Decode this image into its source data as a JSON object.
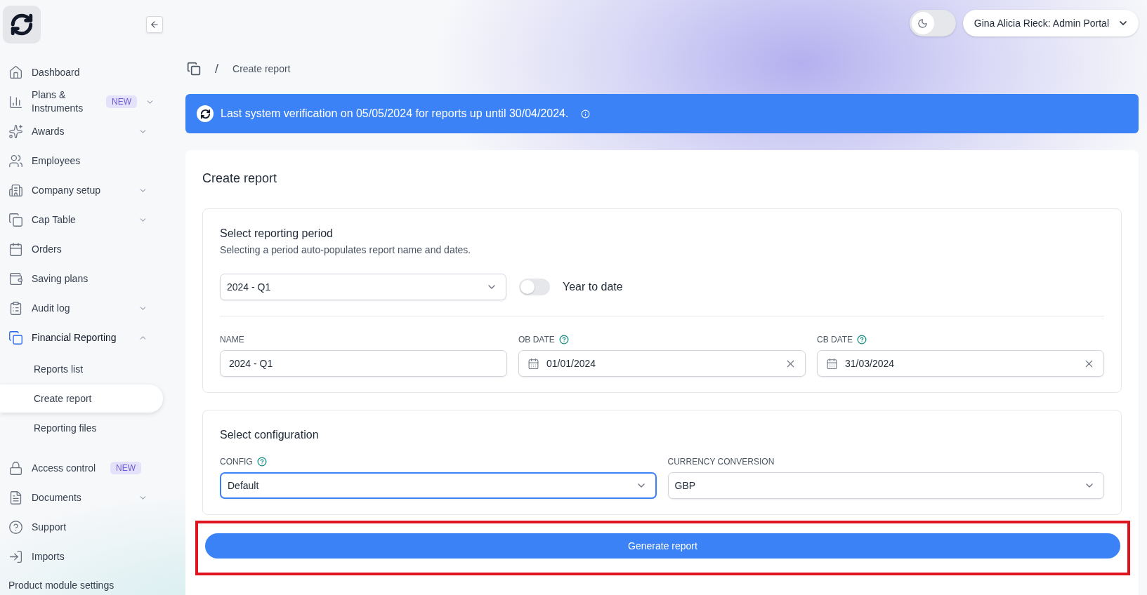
{
  "sidebar": {
    "items": [
      {
        "kind": "link",
        "label": "Dashboard",
        "selected": false
      },
      {
        "kind": "group",
        "label": "Plans & Instruments",
        "badge": "NEW",
        "expanded": false,
        "selected": false
      },
      {
        "kind": "group",
        "label": "Awards",
        "expanded": false,
        "selected": false
      },
      {
        "kind": "link",
        "label": "Employees",
        "selected": false
      },
      {
        "kind": "group",
        "label": "Company setup",
        "expanded": false,
        "selected": false
      },
      {
        "kind": "group",
        "label": "Cap Table",
        "expanded": false,
        "selected": false
      },
      {
        "kind": "link",
        "label": "Orders",
        "selected": false
      },
      {
        "kind": "link",
        "label": "Saving plans",
        "selected": false
      },
      {
        "kind": "group",
        "label": "Audit log",
        "expanded": false,
        "selected": false
      },
      {
        "kind": "group",
        "label": "Financial Reporting",
        "expanded": true,
        "selected": true,
        "children": [
          {
            "label": "Reports list",
            "selected": false
          },
          {
            "label": "Create report",
            "selected": true
          },
          {
            "label": "Reporting files",
            "selected": false
          }
        ]
      },
      {
        "kind": "link",
        "label": "Access control",
        "badge": "NEW",
        "selected": false
      },
      {
        "kind": "group",
        "label": "Documents",
        "expanded": false,
        "selected": false
      },
      {
        "kind": "link",
        "label": "Support",
        "selected": false
      },
      {
        "kind": "link",
        "label": "Imports",
        "selected": false
      }
    ],
    "footer": "Product module settings"
  },
  "topbar": {
    "dark_mode": false,
    "user": "Gina Alicia Rieck: Admin Portal"
  },
  "breadcrumb": {
    "separator": "/",
    "items": [
      "Create report"
    ]
  },
  "banner": "Last system verification on 05/05/2024 for reports up until 30/04/2024.",
  "page_title": "Create report",
  "period": {
    "title": "Select reporting period",
    "subtitle": "Selecting a period auto-populates report name and dates.",
    "value": "2024 - Q1",
    "year_to_date": {
      "label": "Year to date",
      "on": false
    },
    "fields": [
      {
        "kind": "text",
        "label": "NAME",
        "value": "2024 - Q1"
      },
      {
        "kind": "date",
        "label": "OB DATE",
        "value": "01/01/2024"
      },
      {
        "kind": "date",
        "label": "CB DATE",
        "value": "31/03/2024"
      }
    ]
  },
  "configuration": {
    "title": "Select configuration",
    "fields": [
      {
        "label": "CONFIG",
        "help": true,
        "value": "Default",
        "focused": true
      },
      {
        "label": "CURRENCY CONVERSION",
        "help": false,
        "value": "GBP",
        "focused": false
      }
    ]
  },
  "generate": {
    "label": "Generate report",
    "highlighted": true
  }
}
